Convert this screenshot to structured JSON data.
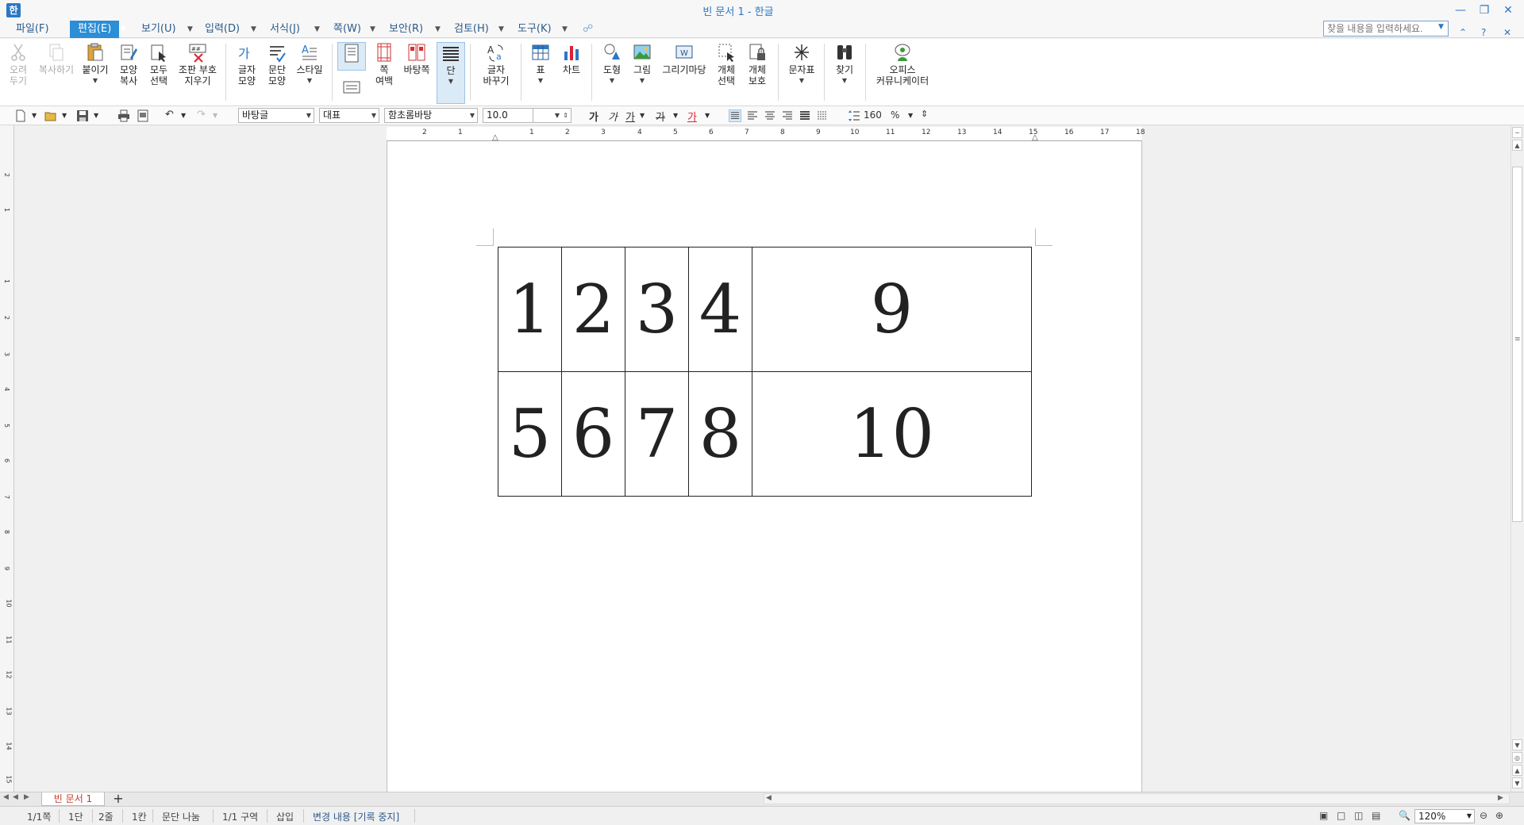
{
  "window": {
    "title": "빈 문서 1 - 한글",
    "logo": "한"
  },
  "menu": {
    "items": [
      "파일(F)",
      "편집(E)",
      "보기(U)",
      "입력(D)",
      "서식(J)",
      "쪽(W)",
      "보안(R)",
      "검토(H)",
      "도구(K)"
    ],
    "active": "편집(E)",
    "help_placeholder": "찾을 내용을 입력하세요."
  },
  "ribbon": {
    "cut": "오려\n두기",
    "copy": "복사하기",
    "paste": "붙이기",
    "shape_copy": "모양\n복사",
    "select_all": "모두\n선택",
    "clear_markup": "조판 부호\n지우기",
    "char_shape": "글자\n모양",
    "para_shape": "문단\n모양",
    "style": "스타일",
    "page_margin": "쪽\n여백",
    "master_page": "바탕쪽",
    "columns": "단",
    "change_case": "글자\n바꾸기",
    "table": "표",
    "chart": "차트",
    "shape": "도형",
    "picture": "그림",
    "drawing": "그리기마당",
    "select_object": "개체\n선택",
    "protect_object": "개체\n보호",
    "char_map": "문자표",
    "find": "찾기",
    "office_comm": "오피스\n커뮤니케이터"
  },
  "format": {
    "style": "바탕글",
    "language": "대표",
    "font": "함초롬바탕",
    "size": "10.0",
    "unit": "pt",
    "line_spacing": "160",
    "line_unit": "%"
  },
  "ruler": {
    "h": [
      "2",
      "1",
      "1",
      "2",
      "3",
      "4",
      "5",
      "6",
      "7",
      "8",
      "9",
      "10",
      "11",
      "12",
      "13",
      "14",
      "15",
      "16",
      "17",
      "18"
    ],
    "v": [
      "2",
      "1",
      "1",
      "2",
      "3",
      "4",
      "5",
      "6",
      "7",
      "8",
      "9",
      "10",
      "11",
      "12",
      "13",
      "14",
      "15"
    ]
  },
  "table": {
    "rows": [
      [
        "1",
        "2",
        "3",
        "4",
        "9"
      ],
      [
        "5",
        "6",
        "7",
        "8",
        "10"
      ]
    ]
  },
  "tab": {
    "name": "빈 문서 1",
    "add": "+"
  },
  "status": {
    "page": "1/1쪽",
    "column": "1단",
    "line": "2줄",
    "col": "1칸",
    "break": "문단 나눔",
    "section": "1/1 구역",
    "insert": "삽입",
    "track": "변경 내용 [기록 중지]",
    "zoom": "120%"
  }
}
